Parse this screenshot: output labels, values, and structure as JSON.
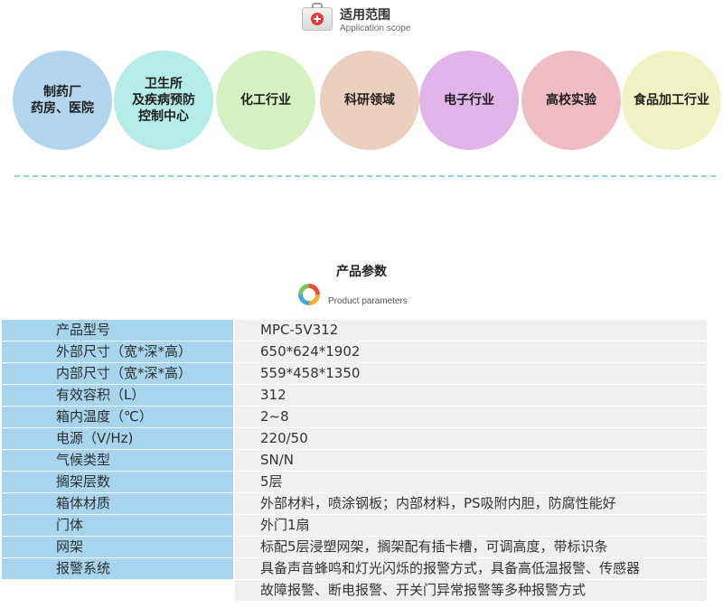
{
  "scope": {
    "title": "适用范围",
    "subtitle": "Application scope",
    "icon": "first-aid-kit-icon",
    "items": [
      {
        "label": "制药厂\n药房、医院",
        "color": "#b3d6ee"
      },
      {
        "label": "卫生所\n及疾病预防\n控制中心",
        "color": "#b6ece7"
      },
      {
        "label": "化工行业",
        "color": "#d6f2c3"
      },
      {
        "label": "科研领域",
        "color": "#ecd0bf"
      },
      {
        "label": "电子行业",
        "color": "#e2b5ea"
      },
      {
        "label": "高校实验",
        "color": "#f1bdc4"
      },
      {
        "label": "食品加工行业",
        "color": "#f1f3c4"
      }
    ]
  },
  "params": {
    "title": "产品参数",
    "subtitle": "Product parameters",
    "icon": "ring-chart-icon",
    "rows": [
      {
        "label": "产品型号",
        "value": "MPC-5V312"
      },
      {
        "label": "外部尺寸（宽*深*高）",
        "value": "650*624*1902"
      },
      {
        "label": "内部尺寸（宽*深*高）",
        "value": "559*458*1350"
      },
      {
        "label": "有效容积（L）",
        "value": "312"
      },
      {
        "label": "箱内温度（℃）",
        "value": "2~8"
      },
      {
        "label": "电源（V/Hz)",
        "value": "220/50"
      },
      {
        "label": "气候类型",
        "value": "SN/N"
      },
      {
        "label": "搁架层数",
        "value": "5层"
      },
      {
        "label": "箱体材质",
        "value": "外部材料，喷涂钢板；内部材料，PS吸附内胆，防腐性能好"
      },
      {
        "label": "门体",
        "value": "外门1扇"
      },
      {
        "label": "网架",
        "value": "标配5层浸塑网架，搁架配有插卡槽，可调高度，带标识条"
      },
      {
        "label": "报警系统",
        "value": "具备声音蜂鸣和灯光闪烁的报警方式，具备高低温报警、传感器"
      },
      {
        "label": "",
        "value": "故障报警、断电报警、开关门异常报警等多种报警方式"
      }
    ]
  }
}
